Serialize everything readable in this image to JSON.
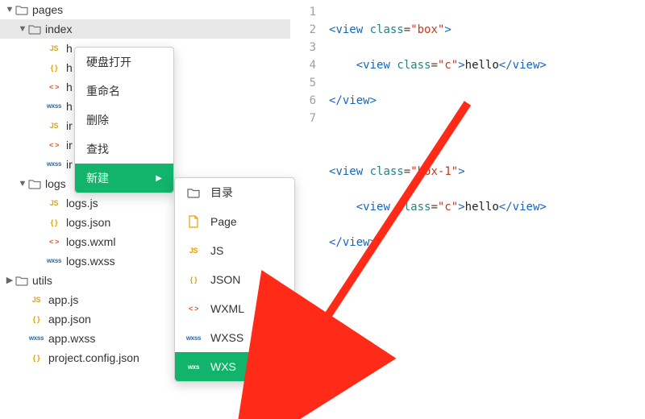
{
  "tree": {
    "pages": "pages",
    "index": "index",
    "h_js": "h",
    "h_json": "h",
    "h_wxml": "h",
    "h_wxss": "h",
    "i_js": "ir",
    "i_wxml": "ir",
    "i_wxss": "ir",
    "logs": "logs",
    "logs_js": "logs.js",
    "logs_json": "logs.json",
    "logs_wxml": "logs.wxml",
    "logs_wxss": "logs.wxss",
    "utils": "utils",
    "app_js": "app.js",
    "app_json": "app.json",
    "app_wxss": "app.wxss",
    "proj": "project.config.json"
  },
  "ctx": {
    "open": "硬盘打开",
    "rename": "重命名",
    "delete": "删除",
    "find": "查找",
    "new": "新建"
  },
  "sub": {
    "dir": "目录",
    "page": "Page",
    "js": "JS",
    "json": "JSON",
    "wxml": "WXML",
    "wxss": "WXSS",
    "wxs": "WXS"
  },
  "badges": {
    "js": "JS",
    "json": "{ }",
    "wxml": "< >",
    "wxss": "wxss",
    "wxs": "wxs"
  },
  "code": {
    "l1": {
      "open": "<",
      "tag": "view",
      "sp": " ",
      "attr": "class",
      "eq": "=",
      "val": "\"box\"",
      "close": ">"
    },
    "l2": {
      "indent": "    ",
      "open": "<",
      "tag": "view",
      "sp": " ",
      "attr": "class",
      "eq": "=",
      "val": "\"c\"",
      "close": ">",
      "text": "hello",
      "copen": "</",
      "ctag": "view",
      "cclose": ">"
    },
    "l3": {
      "copen": "</",
      "ctag": "view",
      "cclose": ">"
    },
    "l5": {
      "open": "<",
      "tag": "view",
      "sp": " ",
      "attr": "class",
      "eq": "=",
      "val": "\"box-1\"",
      "close": ">"
    },
    "l6": {
      "indent": "    ",
      "open": "<",
      "tag": "view",
      "sp": " ",
      "attr": "class",
      "eq": "=",
      "val": "\"c\"",
      "close": ">",
      "text": "hello",
      "copen": "</",
      "ctag": "view",
      "cclose": ">"
    },
    "l7": {
      "copen": "</",
      "ctag": "view",
      "cclose": ">"
    }
  },
  "gutter": [
    "1",
    "2",
    "3",
    "4",
    "5",
    "6",
    "7"
  ],
  "colors": {
    "accent": "#12b36a",
    "arrow": "#ff2a18"
  }
}
